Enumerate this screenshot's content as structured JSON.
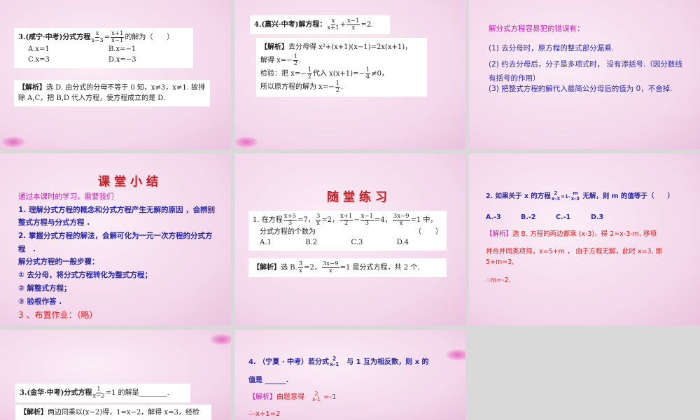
{
  "slide1": {
    "question_prefix": "3.(咸宁·中考)分式方程",
    "f1n": "x",
    "f1d": "x−3",
    "eq": "=",
    "f2n": "x+1",
    "f2d": "x−1",
    "question_suffix": "的解为（　　）",
    "options": [
      "A.x=1",
      "B.x=−1",
      "C.x=3",
      "D.x=−3"
    ],
    "analysis_label": "【解析】",
    "analysis": "选 D. 由分式的分母不等于 0 知，x≠3，x≠1. 故排除 A,C，把 B,D 代入方程，使方程成立的是 D."
  },
  "slide2": {
    "question_prefix": "4.(嘉兴·中考)解方程：",
    "f1n": "x",
    "f1d": "x+1",
    "plus": "+",
    "f2n": "x−1",
    "f2d": "x",
    "question_suffix": "=2.",
    "analysis_label": "【解析】",
    "line1": "去分母得 x²+(x+1)(x−1)=2x(x+1)，",
    "line2_prefix": "解得 x=−",
    "half_n": "1",
    "half_d": "2",
    "line2_suffix": ".",
    "line3_prefix": "检验：把 x=−",
    "line3_mid": "代入 x(x+1)=−",
    "quarter_n": "1",
    "quarter_d": "4",
    "line3_suffix": "≠0，",
    "line4_prefix": "所以原方程的解为 x=−",
    "line4_suffix": "."
  },
  "slide3": {
    "heading": "解分式方程容易犯的错误有：",
    "items": [
      "(1) 去分母时，原方程的整式部分漏乘.",
      "(2) 约去分母后，分子是多项式时， 没有添括号.（因分数线有括号的作用）",
      "(3) 把整式方程的解代入最简公分母后的值为 0，不舍掉."
    ]
  },
  "slide4": {
    "title": "课堂小结",
    "intro": "通过本课时的学习，需要我们",
    "lines": [
      "1. 理解分式方程的概念和分式方程产生无解的原因 ，会辨别整式方程与分式方程 .",
      "2. 掌握分式方程的解法，会解可化为一元一次方程的分式方程　.",
      "解分式方程的一般步骤：",
      "① 去分母，将分式方程转化为整式方程；",
      "② 解整式方程；",
      "③ 验根作答 ."
    ],
    "homework": "3 、布置作业：（略）"
  },
  "slide5": {
    "title": "随堂练习",
    "q_prefix": "1. 在方程",
    "a_n": "x+5",
    "a_d": "3",
    "a_s": "=7，",
    "b_n": "3",
    "b_d": "x",
    "b_s": "=2，",
    "c_n": "x+1",
    "c_d": "2",
    "minus": "−",
    "d_n": "x−1",
    "d_d": "3",
    "d_s": "=4，",
    "e_n": "3x−9",
    "e_d": "x",
    "e_s": "=1 中，",
    "q_line2": "分式方程的个数为",
    "paren": "（　　）",
    "options": [
      "A.1",
      "B.2",
      "C.3",
      "D.4"
    ],
    "analysis_label": "【解析】",
    "analysis_prefix": "选 B.",
    "analysis_mid1": "=2，",
    "analysis_mid2": "=1 是分式方程，共 2 个."
  },
  "slide6": {
    "q_prefix": "2. 如果关于 x 的方程",
    "f1n": "2",
    "f1d": "x-3",
    "mid": "=1-",
    "f2n": "m",
    "f2d": "x-3",
    "q_suffix": "无解，则 m 的值等于（　　）",
    "options": [
      "A.-3",
      "B.-2",
      "C.-1",
      "D.3"
    ],
    "analysis_label": "【解析】",
    "analysis": "选 B. 方程的两边都乘 (x-3)，得 2=x-3-m, 移项",
    "line2": "并合并同类项得，x=5+m ， 由于方程无解，此时 x=3, 即 5+m=3,",
    "line3": "∴m=-2."
  },
  "slide7": {
    "q_prefix": "3.(金华·中考)分式方程",
    "f_n": "1",
    "f_d": "x−2",
    "q_suffix": "=1 的解是________.",
    "analysis_label": "【解析】",
    "analysis": "两边同乘以(x−2)得，1=x−2，解得 x=3，经检"
  },
  "slide8": {
    "q_prefix": "4. （宁夏 · 中考）若分式",
    "f_n": "2",
    "f_d": "x-1",
    "q_suffix": "与 1 互为相反数，则 x 的",
    "q_line2": "值是 ______.",
    "analysis_label": "【解析】",
    "analysis_prefix": "由题意得",
    "analysis_suffix": "=-1",
    "line3": "∴-x+1=2"
  }
}
